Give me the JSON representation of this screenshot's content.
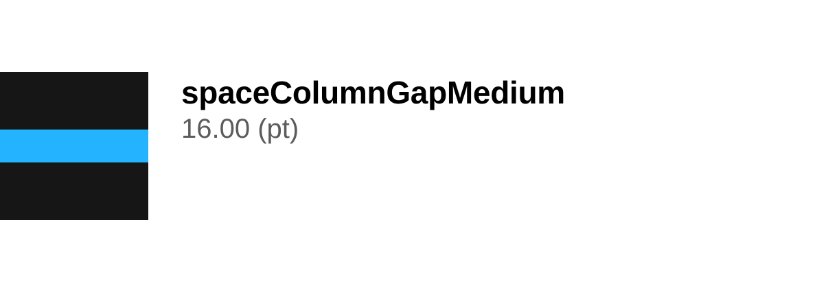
{
  "token": {
    "name": "spaceColumnGapMedium",
    "value": "16.00 (pt)"
  },
  "colors": {
    "swatch_background": "#161616",
    "gap_highlight": "#24b4ff",
    "name_text": "#000000",
    "value_text": "#5c5c5c"
  }
}
